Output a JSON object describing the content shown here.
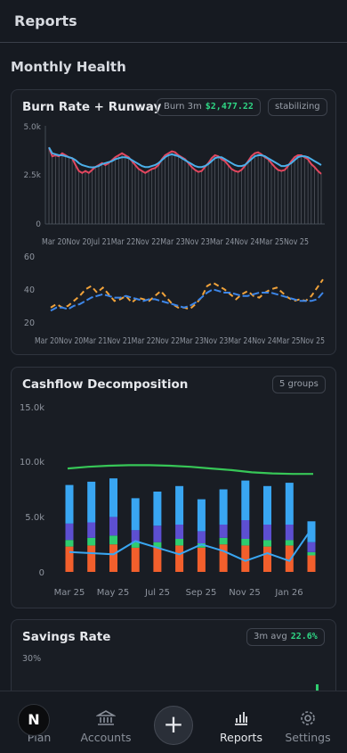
{
  "header": {
    "title": "Reports"
  },
  "section": {
    "title": "Monthly Health"
  },
  "burn_card": {
    "title": "Burn Rate + Runway",
    "pill_label": "Burn 3m",
    "pill_value": "$2,477.22",
    "status": "stabilizing",
    "y_ticks": [
      "5.0k",
      "2.5k",
      "0"
    ],
    "x_tick_run": "Mar 20Nov 20Jul 21Mar 22Nov 22Mar 23Nov 23Mar 24Nov 24Mar 25Nov 25",
    "y2_ticks": [
      "60",
      "40",
      "20"
    ],
    "x2_tick_run": "Mar 20Nov 20Mar 21Nov 21Mar 22Nov 22Mar 23Nov 23Mar 24Nov 24Mar 25Nov 25"
  },
  "cashflow_card": {
    "title": "Cashflow Decomposition",
    "pill": "5 groups",
    "y_ticks": [
      "15.0k",
      "10.0k",
      "5.0k",
      "0"
    ],
    "x_ticks": [
      "Mar 25",
      "May 25",
      "Jul 25",
      "Sep 25",
      "Nov 25",
      "Jan 26"
    ]
  },
  "savings_card": {
    "title": "Savings Rate",
    "pill_label": "3m avg",
    "pill_value": "22.6%",
    "y_tick": "30%"
  },
  "nav": {
    "avatar": "N",
    "plan": "Plan",
    "accounts": "Accounts",
    "add": "+",
    "reports": "Reports",
    "settings": "Settings"
  },
  "colors": {
    "red_line": "#e2475f",
    "blue_line": "#4bb0ea",
    "orange_dash": "#f0a23a",
    "blue_dash": "#3d86e8",
    "green_line": "#37c757",
    "bar_orange": "#f25f2c",
    "bar_green": "#2fcd6f",
    "bar_purple": "#5d4fd1",
    "bar_blue": "#39a6f2"
  },
  "chart_data": [
    {
      "type": "line",
      "title": "Burn Rate + Runway",
      "ylim": [
        0,
        5000
      ],
      "series": [
        {
          "values": [
            3900,
            3450,
            3500,
            3450,
            3600,
            3500,
            3400,
            3350,
            3000,
            2700,
            2600,
            2700,
            2600,
            2750,
            2900,
            3000,
            3100,
            3000,
            3100,
            3250,
            3400,
            3500,
            3600,
            3500,
            3400,
            3200,
            3000,
            2800,
            2700,
            2600,
            2700,
            2800,
            2850,
            3000,
            3300,
            3500,
            3600,
            3700,
            3650,
            3500,
            3400,
            3300,
            3100,
            2900,
            2750,
            2650,
            2700,
            2900,
            3100,
            3350,
            3500,
            3450,
            3300,
            3200,
            3000,
            2800,
            2700,
            2650,
            2750,
            2950,
            3200,
            3450,
            3600,
            3650,
            3550,
            3400,
            3300,
            3100,
            2900,
            2750,
            2700,
            2750,
            2950,
            3200,
            3400,
            3500,
            3500,
            3400,
            3300,
            3050,
            2900,
            2700,
            2550
          ]
        },
        {
          "values": [
            3900,
            3600,
            3550,
            3500,
            3500,
            3450,
            3400,
            3350,
            3250,
            3100,
            3000,
            2950,
            2900,
            2880,
            2900,
            2950,
            3050,
            3100,
            3150,
            3200,
            3300,
            3350,
            3400,
            3400,
            3350,
            3250,
            3150,
            3050,
            2950,
            2900,
            2900,
            2950,
            3000,
            3100,
            3250,
            3400,
            3500,
            3550,
            3500,
            3450,
            3350,
            3250,
            3150,
            3050,
            2950,
            2900,
            2900,
            2950,
            3050,
            3200,
            3350,
            3400,
            3400,
            3300,
            3200,
            3100,
            3000,
            2950,
            2950,
            3000,
            3150,
            3300,
            3450,
            3500,
            3500,
            3450,
            3350,
            3250,
            3150,
            3050,
            2950,
            2950,
            3000,
            3100,
            3250,
            3400,
            3450,
            3450,
            3400,
            3300,
            3200,
            3100,
            3000
          ]
        }
      ]
    },
    {
      "type": "line",
      "ylim": [
        20,
        60
      ],
      "series": [
        {
          "values": [
            31,
            33,
            31,
            32,
            35,
            38,
            42,
            44,
            40,
            43,
            39,
            35,
            36,
            38,
            34,
            37,
            36,
            35,
            38,
            41,
            37,
            33,
            31,
            31,
            30,
            33,
            37,
            44,
            46,
            44,
            42,
            39,
            36,
            39,
            41,
            38,
            37,
            40,
            42,
            43,
            40,
            37,
            35,
            36,
            35,
            38,
            43,
            48
          ]
        },
        {
          "values": [
            29,
            31,
            31,
            30,
            32,
            33,
            35,
            37,
            38,
            39,
            38,
            37,
            37,
            38,
            37,
            36,
            35,
            36,
            36,
            35,
            34,
            33,
            32,
            31,
            32,
            34,
            37,
            40,
            42,
            41,
            40,
            40,
            39,
            38,
            38,
            39,
            40,
            40,
            40,
            39,
            38,
            37,
            36,
            35,
            35,
            35,
            36,
            40
          ]
        }
      ]
    },
    {
      "type": "bar",
      "title": "Cashflow Decomposition",
      "categories": [
        "Mar 25",
        "Apr 25",
        "May 25",
        "Jun 25",
        "Jul 25",
        "Aug 25",
        "Sep 25",
        "Oct 25",
        "Nov 25",
        "Dec 25",
        "Jan 26",
        "Feb 26"
      ],
      "ylim": [
        0,
        15000
      ],
      "series": [
        {
          "values": [
            2300,
            2400,
            2500,
            2200,
            2200,
            2400,
            2200,
            2500,
            2400,
            2300,
            2400,
            1500
          ]
        },
        {
          "values": [
            600,
            700,
            800,
            500,
            500,
            600,
            400,
            600,
            600,
            600,
            500,
            300
          ]
        },
        {
          "values": [
            1500,
            1400,
            1700,
            1100,
            1500,
            1300,
            1100,
            1200,
            1700,
            1400,
            1400,
            900
          ]
        },
        {
          "values": [
            3500,
            3700,
            3500,
            2900,
            3100,
            3500,
            2900,
            3200,
            3600,
            3500,
            3800,
            1900
          ]
        }
      ],
      "lines": [
        {
          "values": [
            9400,
            9550,
            9650,
            9700,
            9700,
            9650,
            9550,
            9400,
            9250,
            9050,
            8950,
            8900,
            8900
          ]
        },
        {
          "values": [
            1800,
            1700,
            1600,
            2800,
            2200,
            1600,
            2500,
            1900,
            1000,
            1700,
            1000,
            3900
          ]
        }
      ]
    }
  ]
}
